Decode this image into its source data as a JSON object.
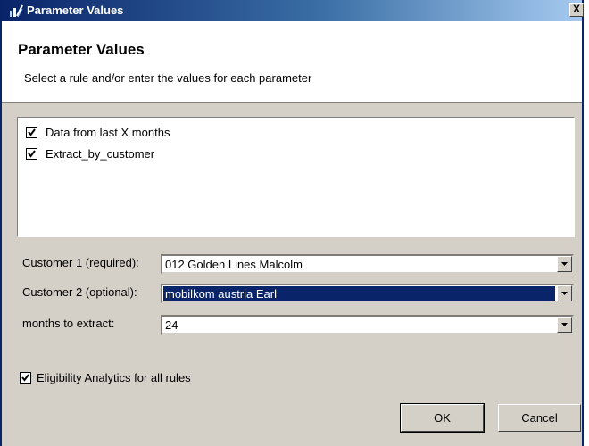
{
  "window": {
    "title": "Parameter Values",
    "close_label": "X"
  },
  "header": {
    "title": "Parameter Values",
    "subtitle": "Select a rule and/or enter the values for each parameter"
  },
  "rules": [
    {
      "label": "Data from last X months",
      "checked": true
    },
    {
      "label": "Extract_by_customer",
      "checked": true
    }
  ],
  "parameters": [
    {
      "label": "Customer 1 (required):",
      "value": "012 Golden Lines Malcolm",
      "selected": false
    },
    {
      "label": "Customer 2 (optional):",
      "value": "mobilkom austria Earl",
      "selected": true
    },
    {
      "label": "months to extract:",
      "value": "24",
      "selected": false
    }
  ],
  "eligibility": {
    "label": "Eligibility Analytics for all rules",
    "checked": true
  },
  "buttons": {
    "ok": "OK",
    "cancel": "Cancel"
  },
  "colors": {
    "title_bar": "#0a246a",
    "selection": "#0a246a",
    "dialog_bg": "#d4d0c8"
  }
}
